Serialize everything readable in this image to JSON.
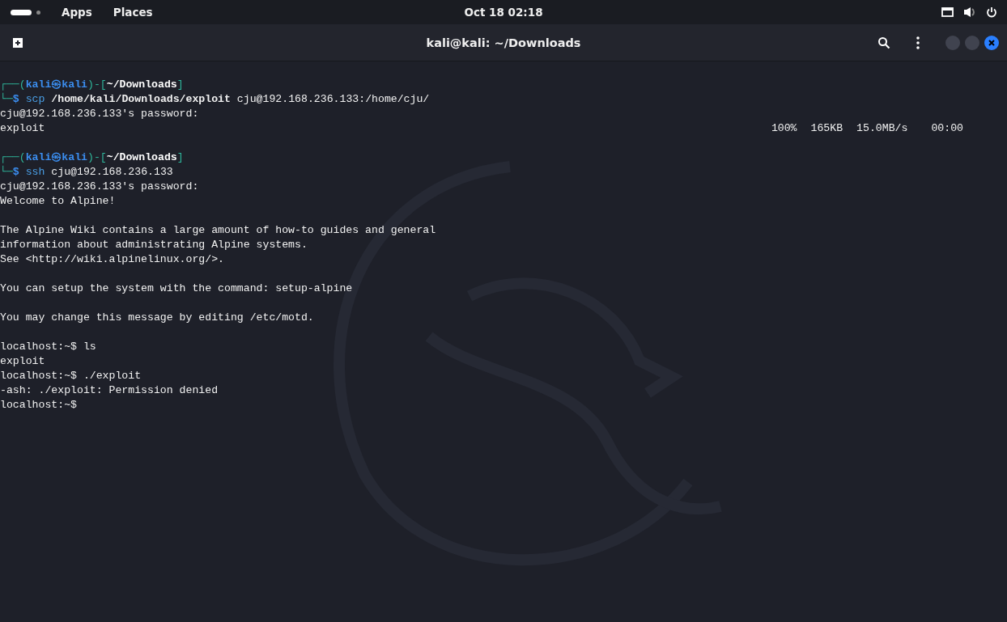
{
  "top_bar": {
    "menus": [
      "Apps",
      "Places"
    ],
    "clock": "Oct 18  02:18"
  },
  "window": {
    "title": "kali@kali: ~/Downloads"
  },
  "terminal": {
    "lines": [
      {
        "kind": "prompt",
        "open": "┌──(",
        "user_host": "kali㉿kali",
        "sep": ")-[",
        "dir": "~/Downloads",
        "close": "]",
        "mark": "└─$",
        "command": "scp",
        "args": [
          {
            "text": "/home/kali/Downloads/exploit",
            "bold": true
          },
          {
            "text": "cju@192.168.236.133:/home/cju/",
            "bold": false
          }
        ]
      },
      {
        "kind": "output",
        "text": "cju@192.168.236.133's password:"
      },
      {
        "kind": "transfer",
        "file": "exploit",
        "stats": [
          "100%",
          "165KB",
          "15.0MB/s",
          "00:00"
        ]
      },
      {
        "kind": "blank"
      },
      {
        "kind": "prompt",
        "open": "┌──(",
        "user_host": "kali㉿kali",
        "sep": ")-[",
        "dir": "~/Downloads",
        "close": "]",
        "mark": "└─$",
        "command": "ssh",
        "args": [
          {
            "text": "cju@192.168.236.133",
            "bold": false
          }
        ]
      },
      {
        "kind": "output",
        "text": "cju@192.168.236.133's password:"
      },
      {
        "kind": "output",
        "text": "Welcome to Alpine!"
      },
      {
        "kind": "blank"
      },
      {
        "kind": "output",
        "text": "The Alpine Wiki contains a large amount of how-to guides and general"
      },
      {
        "kind": "output",
        "text": "information about administrating Alpine systems."
      },
      {
        "kind": "output",
        "text": "See <http://wiki.alpinelinux.org/>."
      },
      {
        "kind": "blank"
      },
      {
        "kind": "output",
        "text": "You can setup the system with the command: setup-alpine"
      },
      {
        "kind": "blank"
      },
      {
        "kind": "output",
        "text": "You may change this message by editing /etc/motd."
      },
      {
        "kind": "blank"
      },
      {
        "kind": "output",
        "text": "localhost:~$ ls"
      },
      {
        "kind": "output",
        "text": "exploit"
      },
      {
        "kind": "output",
        "text": "localhost:~$ ./exploit"
      },
      {
        "kind": "output",
        "text": "-ash: ./exploit: Permission denied"
      },
      {
        "kind": "output",
        "text": "localhost:~$"
      }
    ]
  }
}
